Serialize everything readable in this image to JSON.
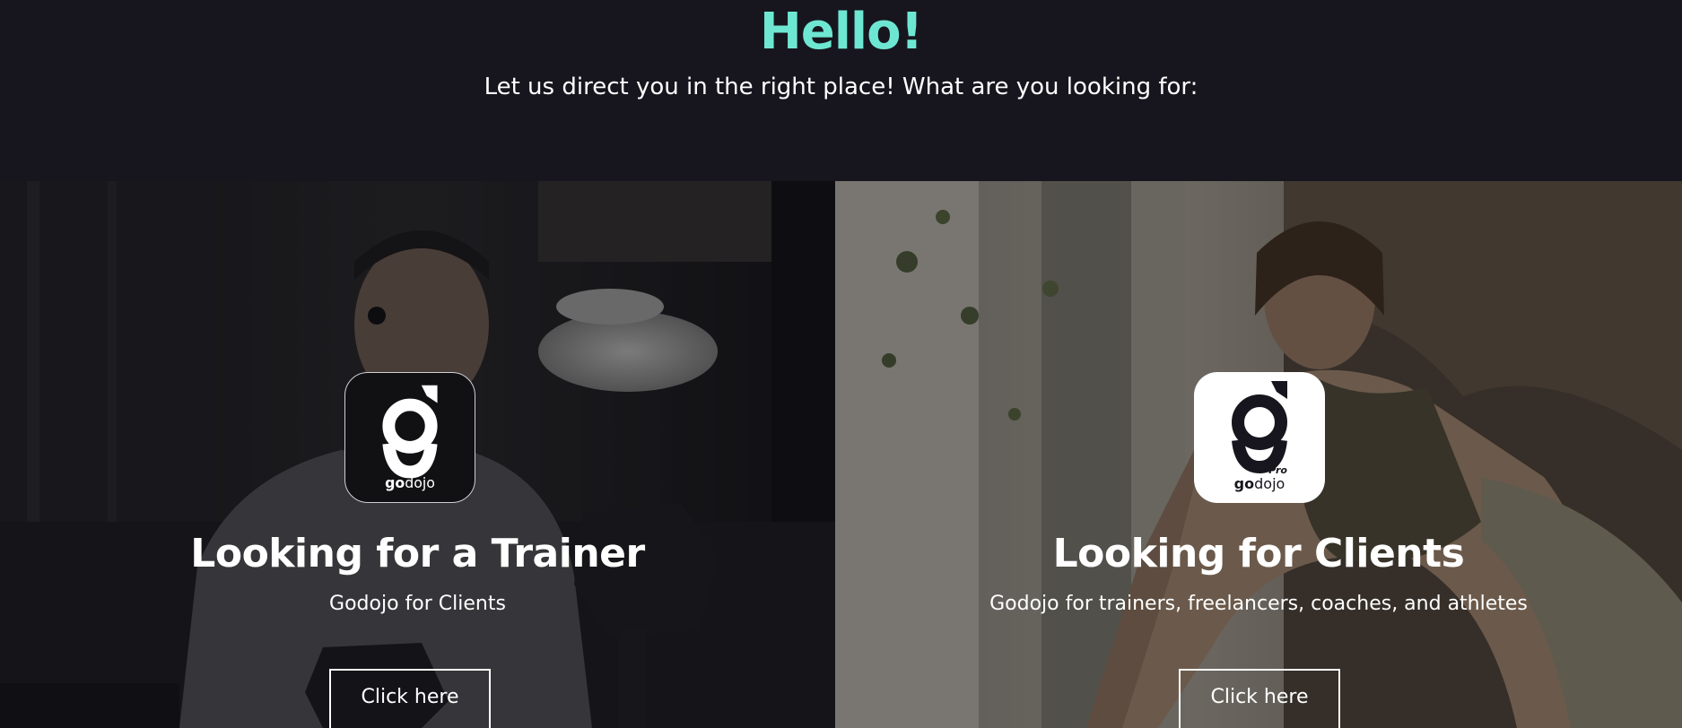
{
  "header": {
    "title": "Hello!",
    "subtitle": "Let us direct you in the right place! What are you looking for:"
  },
  "cards": [
    {
      "logo": {
        "wordmark_bold": "go",
        "wordmark_light": "dojo",
        "badge": "",
        "icon": "godojo-logo-icon"
      },
      "title": "Looking for a Trainer",
      "description": "Godojo for Clients",
      "button_label": "Click here"
    },
    {
      "logo": {
        "wordmark_bold": "go",
        "wordmark_light": "dojo",
        "badge": "Pro",
        "icon": "godojo-pro-logo-icon"
      },
      "title": "Looking for Clients",
      "description": "Godojo for trainers, freelancers, coaches, and athletes",
      "button_label": "Click here"
    }
  ],
  "colors": {
    "background": "#17161e",
    "accent": "#6ee7d2",
    "text": "#ffffff"
  }
}
